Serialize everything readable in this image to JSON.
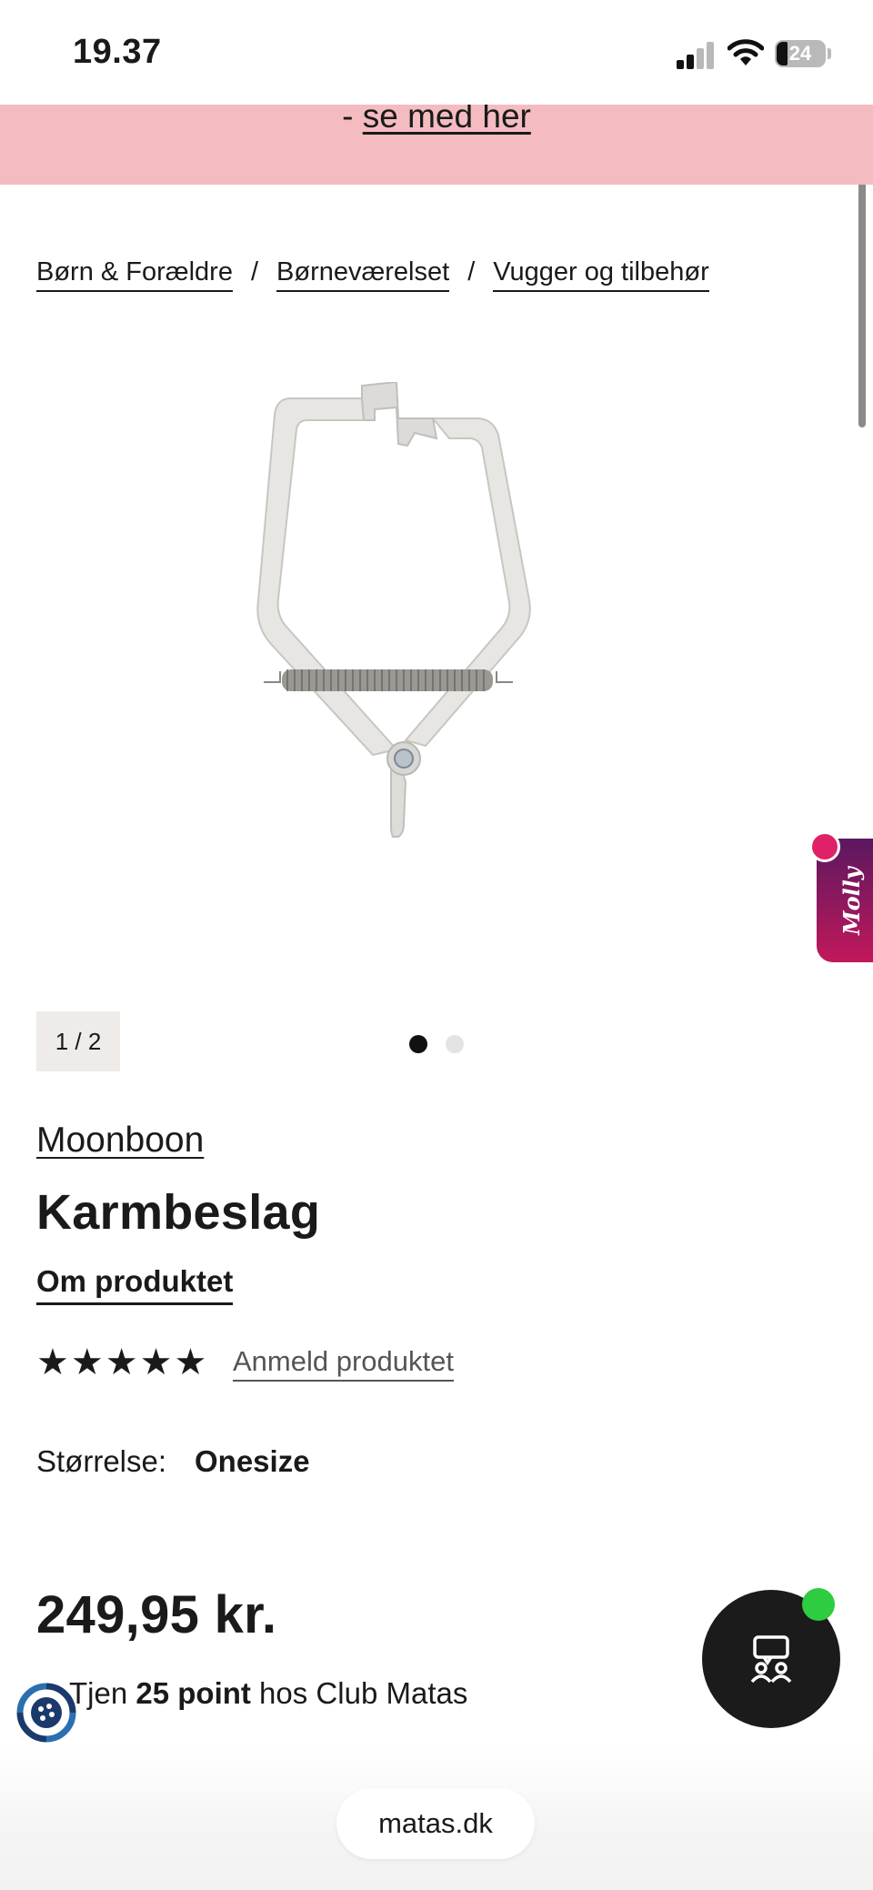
{
  "status_bar": {
    "time": "19.37",
    "battery": "24",
    "battery_level": 0.24
  },
  "promo": {
    "prefix": "- ",
    "link": "se med her"
  },
  "breadcrumb": {
    "items": [
      "Børn & Forældre",
      "Børneværelset",
      "Vugger og tilbehør"
    ],
    "separator": "/"
  },
  "gallery": {
    "counter": "1 / 2",
    "total_dots": 2,
    "active_dot": 1
  },
  "molly": {
    "label": "Molly"
  },
  "product": {
    "brand": "Moonboon",
    "title": "Karmbeslag",
    "about_link": "Om produktet",
    "rating": 5,
    "review_link": "Anmeld produktet",
    "size_label": "Størrelse:",
    "size_value": "Onesize",
    "price": "249,95 kr.",
    "points_prefix": "Tjen ",
    "points_bold": "25 point",
    "points_suffix": " hos Club Matas"
  },
  "browser": {
    "url": "matas.dk"
  },
  "icons": {
    "signal": "cellular-signal-icon",
    "wifi": "wifi-icon",
    "chat": "chat-support-icon",
    "loyalty": "club-matas-badge-icon"
  },
  "colors": {
    "promo_bg": "#f4bcc0",
    "molly_gradient_top": "#5a1860",
    "molly_gradient_bottom": "#c2185b",
    "chat_online": "#2ecc40"
  }
}
